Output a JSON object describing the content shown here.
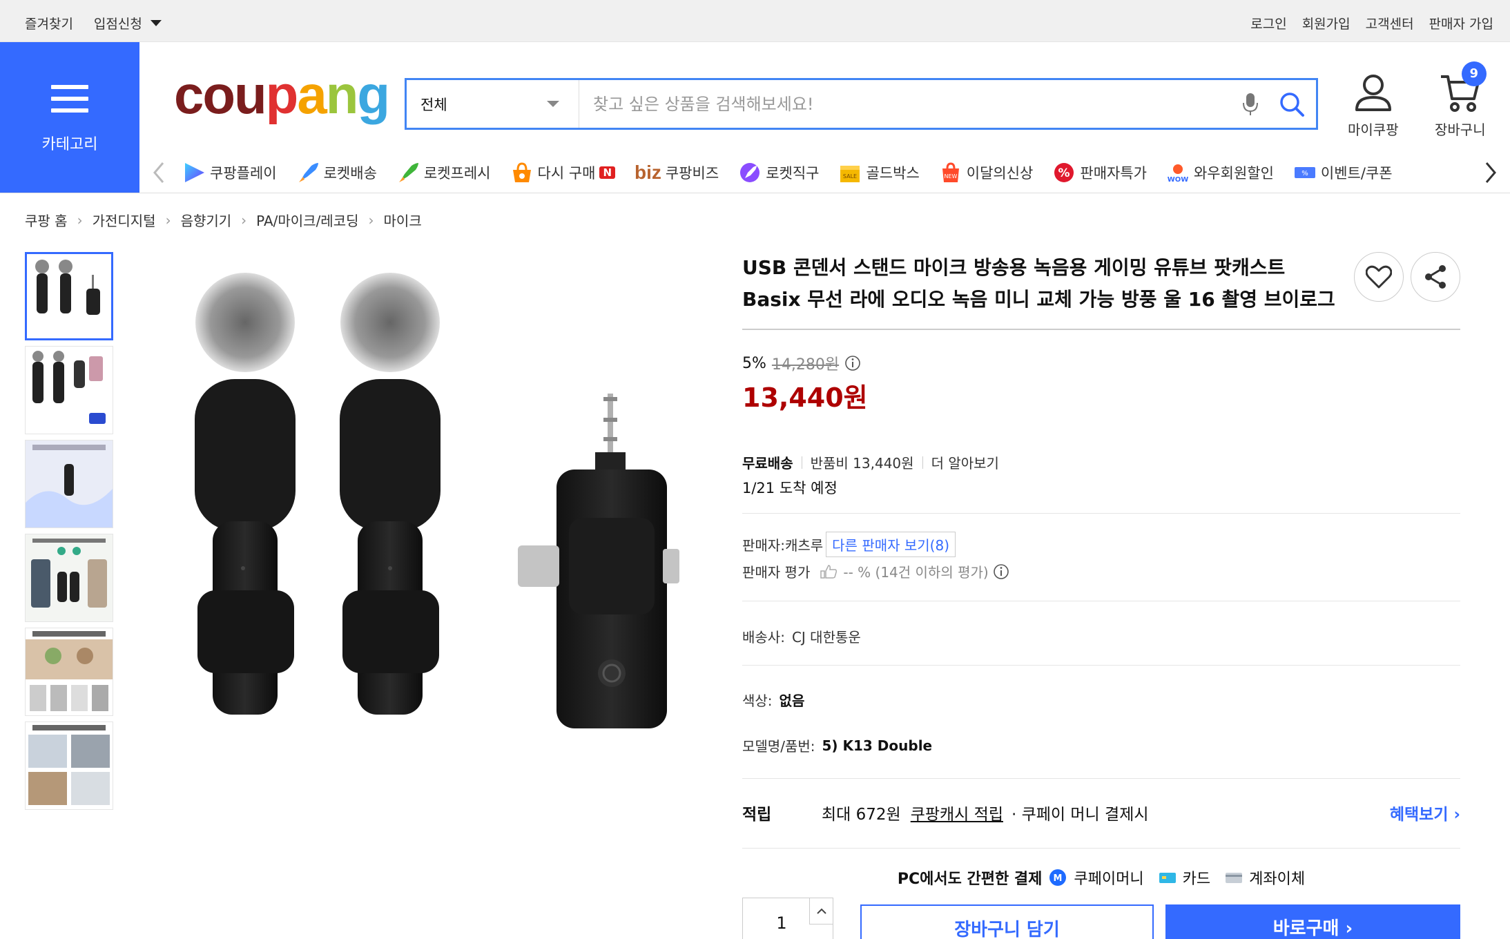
{
  "topbar": {
    "left": {
      "favorites": "즐겨찾기",
      "seller_apply": "입점신청"
    },
    "right": {
      "login": "로그인",
      "signup": "회원가입",
      "customer_center": "고객센터",
      "seller_signup": "판매자 가입"
    }
  },
  "header": {
    "category_label": "카테고리",
    "logo": {
      "c1": "cou",
      "c2": "p",
      "c3": "a",
      "c4": "n",
      "c5": "g"
    },
    "search": {
      "scope": "전체",
      "placeholder": "찾고 싶은 상품을 검색해보세요!"
    },
    "my_coupang": "마이쿠팡",
    "cart": "장바구니",
    "cart_count": "9",
    "accent": "#346aff"
  },
  "catnav": [
    {
      "label": "쿠팡플레이",
      "icon": "play-icon"
    },
    {
      "label": "로켓배송",
      "icon": "rocket-icon"
    },
    {
      "label": "로켓프레시",
      "icon": "rocket-fresh-icon"
    },
    {
      "label": "다시 구매",
      "icon": "rebuy-icon",
      "badge": "N"
    },
    {
      "label": "쿠팡비즈",
      "icon": "biz-icon",
      "prefix": "biz"
    },
    {
      "label": "로켓직구",
      "icon": "rocket-global-icon"
    },
    {
      "label": "골드박스",
      "icon": "goldbox-icon"
    },
    {
      "label": "이달의신상",
      "icon": "new-bag-icon"
    },
    {
      "label": "판매자특가",
      "icon": "percent-badge-icon"
    },
    {
      "label": "와우회원할인",
      "icon": "wow-icon"
    },
    {
      "label": "이벤트/쿠폰",
      "icon": "coupon-icon"
    }
  ],
  "breadcrumb": [
    "쿠팡 홈",
    "가전디지털",
    "음향기기",
    "PA/마이크/레코딩",
    "마이크"
  ],
  "product": {
    "title": "USB 콘덴서 스탠드 마이크 방송용 녹음용 게이밍 유튜브 팟캐스트 Basix 무선 라에 오디오 녹음 미니 교체 가능 방풍 울 16 촬영 브이로그",
    "discount_rate": "5%",
    "original_price": "14,280원",
    "sale_price": "13,440원",
    "shipping": {
      "free": "무료배송",
      "return_fee": "반품비 13,440원",
      "more": "더 알아보기",
      "arrival": "1/21 도착 예정"
    },
    "seller": {
      "label": "판매자:",
      "name": "캐츠루",
      "other_sellers": "다른 판매자 보기(8)",
      "rating_label": "판매자 평가",
      "rating_value": "-- % (14건 이하의 평가)"
    },
    "carrier": {
      "label": "배송사:",
      "value": "CJ 대한통운"
    },
    "color": {
      "label": "색상:",
      "value": "없음"
    },
    "model": {
      "label": "모델명/품번:",
      "value": "5) K13 Double"
    },
    "reward": {
      "label": "적립",
      "max": "최대 672원",
      "cash": "쿠팡캐시 적립",
      "rest": "· 쿠페이 머니 결제시",
      "benefit": "혜택보기"
    },
    "pay": {
      "title": "PC에서도 간편한 결제",
      "coupay": "쿠페이머니",
      "card": "카드",
      "transfer": "계좌이체"
    },
    "quantity": "1",
    "add_to_cart": "장바구니 담기",
    "buy_now": "바로구매"
  }
}
